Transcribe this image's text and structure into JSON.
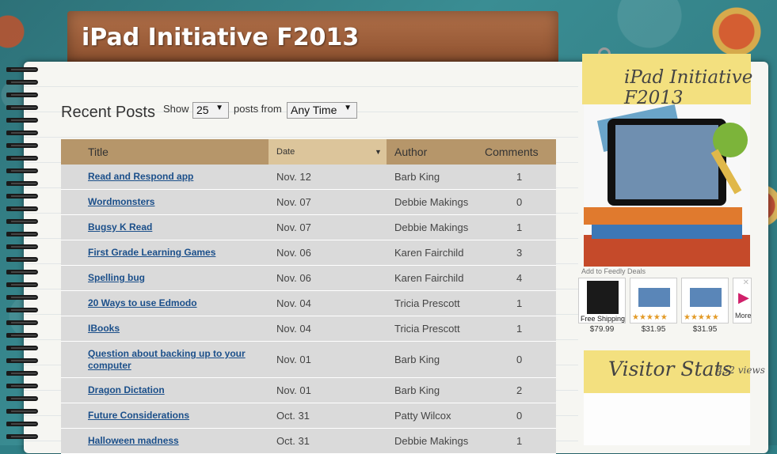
{
  "blog": {
    "title": "iPad Initiative F2013"
  },
  "main": {
    "heading": "Recent Posts",
    "filter": {
      "show_label": "Show",
      "count_value": "25",
      "posts_from_label": "posts from",
      "range_value": "Any Time"
    },
    "table": {
      "columns": [
        "Title",
        "Date",
        "Author",
        "Comments"
      ],
      "sort_column": "Date",
      "rows": [
        {
          "title": "Read and Respond app",
          "date": "Nov. 12",
          "author": "Barb King",
          "comments": "1"
        },
        {
          "title": "Wordmonsters",
          "date": "Nov. 07",
          "author": "Debbie Makings",
          "comments": "0"
        },
        {
          "title": "Bugsy K Read",
          "date": "Nov. 07",
          "author": "Debbie Makings",
          "comments": "1"
        },
        {
          "title": "First Grade Learning Games",
          "date": "Nov. 06",
          "author": "Karen Fairchild",
          "comments": "3"
        },
        {
          "title": "Spelling bug",
          "date": "Nov. 06",
          "author": "Karen Fairchild",
          "comments": "4"
        },
        {
          "title": "20 Ways to use Edmodo",
          "date": "Nov. 04",
          "author": "Tricia Prescott",
          "comments": "1"
        },
        {
          "title": "IBooks",
          "date": "Nov. 04",
          "author": "Tricia Prescott",
          "comments": "1"
        },
        {
          "title": "Question about backing up to your computer",
          "date": "Nov. 01",
          "author": "Barb King",
          "comments": "0"
        },
        {
          "title": "Dragon Dictation",
          "date": "Nov. 01",
          "author": "Barb King",
          "comments": "2"
        },
        {
          "title": "Future Considerations",
          "date": "Oct. 31",
          "author": "Patty Wilcox",
          "comments": "0"
        },
        {
          "title": "Halloween madness",
          "date": "Oct. 31",
          "author": "Debbie Makings",
          "comments": "1"
        }
      ]
    }
  },
  "sidebar": {
    "title": "iPad Initiative F2013",
    "feedly_label": "Add to Feedly Deals",
    "deals": [
      {
        "caption": "Free Shipping",
        "price": "$79.99"
      },
      {
        "caption": "",
        "price": "$31.95"
      },
      {
        "caption": "",
        "price": "$31.95"
      }
    ],
    "more_label": "More",
    "stats": {
      "title": "Visitor Stats",
      "views": "452 views"
    }
  },
  "colors": {
    "background": "#2f7f86",
    "title_tab": "#9a5a36",
    "table_header": "#b6966a",
    "sorted_header": "#dcc59b",
    "row_bg": "#dadada",
    "link": "#1b4f8a",
    "sticky_note": "#f3e07f"
  }
}
